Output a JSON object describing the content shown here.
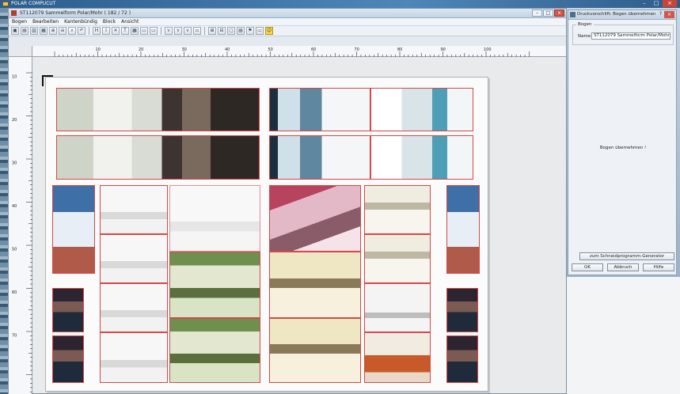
{
  "os": {
    "title": "POLAR COMPUCUT",
    "controls": [
      "–",
      "□",
      "×"
    ]
  },
  "main_window": {
    "title": "ST112079 Sammelform Polar/Mohr ( 182 / 72 )",
    "menu": [
      "Bogen",
      "Bearbeiten",
      "Kantenbündig",
      "Block",
      "Ansicht"
    ],
    "toolbar_icons": [
      "new-icon",
      "open-icon",
      "save-icon",
      "print-icon",
      "zoom-in-icon",
      "zoom-out-icon",
      "search-icon",
      "undo-icon",
      "sep",
      "h-cut-icon",
      "v-cut-icon",
      "delete-icon",
      "text-icon",
      "grid-icon",
      "copy-icon",
      "paste-icon",
      "sep",
      "split-icon",
      "split-v-icon",
      "split-x-icon",
      "disabled-icon",
      "sep",
      "plus-icon",
      "minus-icon",
      "frame-icon",
      "layout-icon",
      "flag-icon",
      "window-icon",
      "smile-icon"
    ],
    "toolbar_glyphs": [
      "▣",
      "▤",
      "▥",
      "▦",
      "⊕",
      "⊖",
      "⌕",
      "↶",
      "",
      "H",
      "Ι",
      "✕",
      "T",
      "▦",
      "▭",
      "▭",
      "",
      "⋎",
      "⋎",
      "⋎",
      "▫",
      "",
      "⊞",
      "⊟",
      "▢",
      "▤",
      "⚑",
      "▭",
      "☺"
    ]
  },
  "ruler": {
    "top_labels": [
      "10",
      "20",
      "30",
      "40",
      "50",
      "60",
      "70",
      "80",
      "90",
      "100"
    ],
    "left_labels": [
      "10",
      "20",
      "30",
      "40",
      "50",
      "60",
      "70"
    ]
  },
  "dialog": {
    "title": "Druckvorschlift: Bogen übernehmen",
    "help": "?",
    "group_label": "Bogen",
    "name_label": "Name",
    "name_value": "ST112079 Sammelform Polar/Mohr",
    "message": "Bogen übernehmen !",
    "generator_button": "zum Schneidprogramm-Generator",
    "ok_button": "OK",
    "abort_button": "Abbruch",
    "help_button": "Hilfe"
  },
  "colors": {
    "cut_line": "#d44848",
    "window_title_bar": "#c3d3e4",
    "close_button": "#d2574b"
  }
}
